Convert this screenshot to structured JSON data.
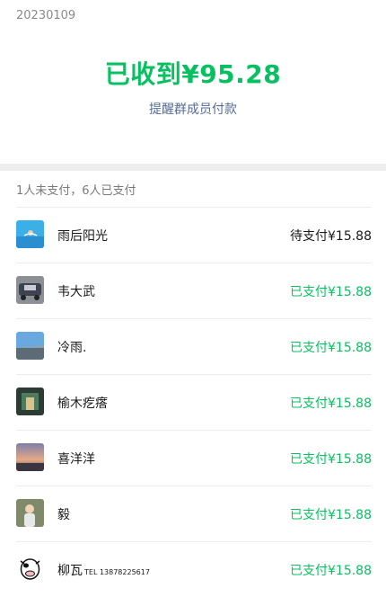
{
  "header": {
    "date": "20230109",
    "amount_text": "已收到¥95.28",
    "remind_link": "提醒群成员付款"
  },
  "summary": "1人未支付，6人已支付",
  "members": [
    {
      "name": "雨后阳光",
      "status": "待支付¥15.88",
      "paid": false,
      "avatar": "swimmer-avatar"
    },
    {
      "name": "韦大武",
      "status": "已支付¥15.88",
      "paid": true,
      "avatar": "car-avatar"
    },
    {
      "name": "冷雨.",
      "status": "已支付¥15.88",
      "paid": true,
      "avatar": "sky-avatar"
    },
    {
      "name": "榆木疙瘩",
      "status": "已支付¥15.88",
      "paid": true,
      "avatar": "street-avatar"
    },
    {
      "name": "喜洋洋",
      "status": "已支付¥15.88",
      "paid": true,
      "avatar": "sunset-avatar"
    },
    {
      "name": "毅",
      "status": "已支付¥15.88",
      "paid": true,
      "avatar": "child-avatar"
    },
    {
      "name": "柳瓦",
      "name_suffix": "TEL 13878225617",
      "status": "已支付¥15.88",
      "paid": true,
      "avatar": "cow-avatar"
    }
  ],
  "colors": {
    "paid": "#07c160",
    "link": "#576b95",
    "divider": "#ededed"
  }
}
